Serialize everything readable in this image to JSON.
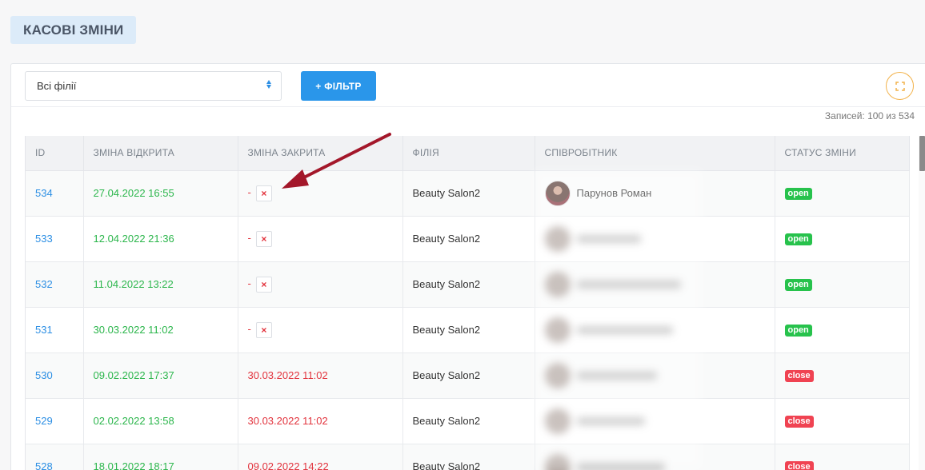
{
  "page": {
    "title": "КАСОВІ ЗМІНИ"
  },
  "toolbar": {
    "branch_select": "Всі філії",
    "filter_button": "+ ФІЛЬТР"
  },
  "records_info": "Записей: 100 из 534",
  "table": {
    "columns": [
      "ID",
      "ЗМІНА ВІДКРИТА",
      "ЗМІНА ЗАКРИТА",
      "ФІЛІЯ",
      "СПІВРОБІТНИК",
      "СТАТУС ЗМІНИ"
    ],
    "rows": [
      {
        "id": "534",
        "opened": "27.04.2022 16:55",
        "closed": "-",
        "branch": "Beauty Salon2",
        "employee": "Парунов Роман",
        "status": "open"
      },
      {
        "id": "533",
        "opened": "12.04.2022 21:36",
        "closed": "-",
        "branch": "Beauty Salon2",
        "employee": "",
        "status": "open"
      },
      {
        "id": "532",
        "opened": "11.04.2022 13:22",
        "closed": "-",
        "branch": "Beauty Salon2",
        "employee": "",
        "status": "open"
      },
      {
        "id": "531",
        "opened": "30.03.2022 11:02",
        "closed": "-",
        "branch": "Beauty Salon2",
        "employee": "",
        "status": "open"
      },
      {
        "id": "530",
        "opened": "09.02.2022 17:37",
        "closed": "30.03.2022 11:02",
        "branch": "Beauty Salon2",
        "employee": "",
        "status": "close"
      },
      {
        "id": "529",
        "opened": "02.02.2022 13:58",
        "closed": "30.03.2022 11:02",
        "branch": "Beauty Salon2",
        "employee": "",
        "status": "close"
      },
      {
        "id": "528",
        "opened": "18.01.2022 18:17",
        "closed": "09.02.2022 14:22",
        "branch": "Beauty Salon2",
        "employee": "",
        "status": "close"
      }
    ]
  },
  "close_shift_icon": "×",
  "colors": {
    "accent": "#2a96ea",
    "open": "#27c24c",
    "close": "#f04352",
    "arrow": "#a3172a"
  }
}
